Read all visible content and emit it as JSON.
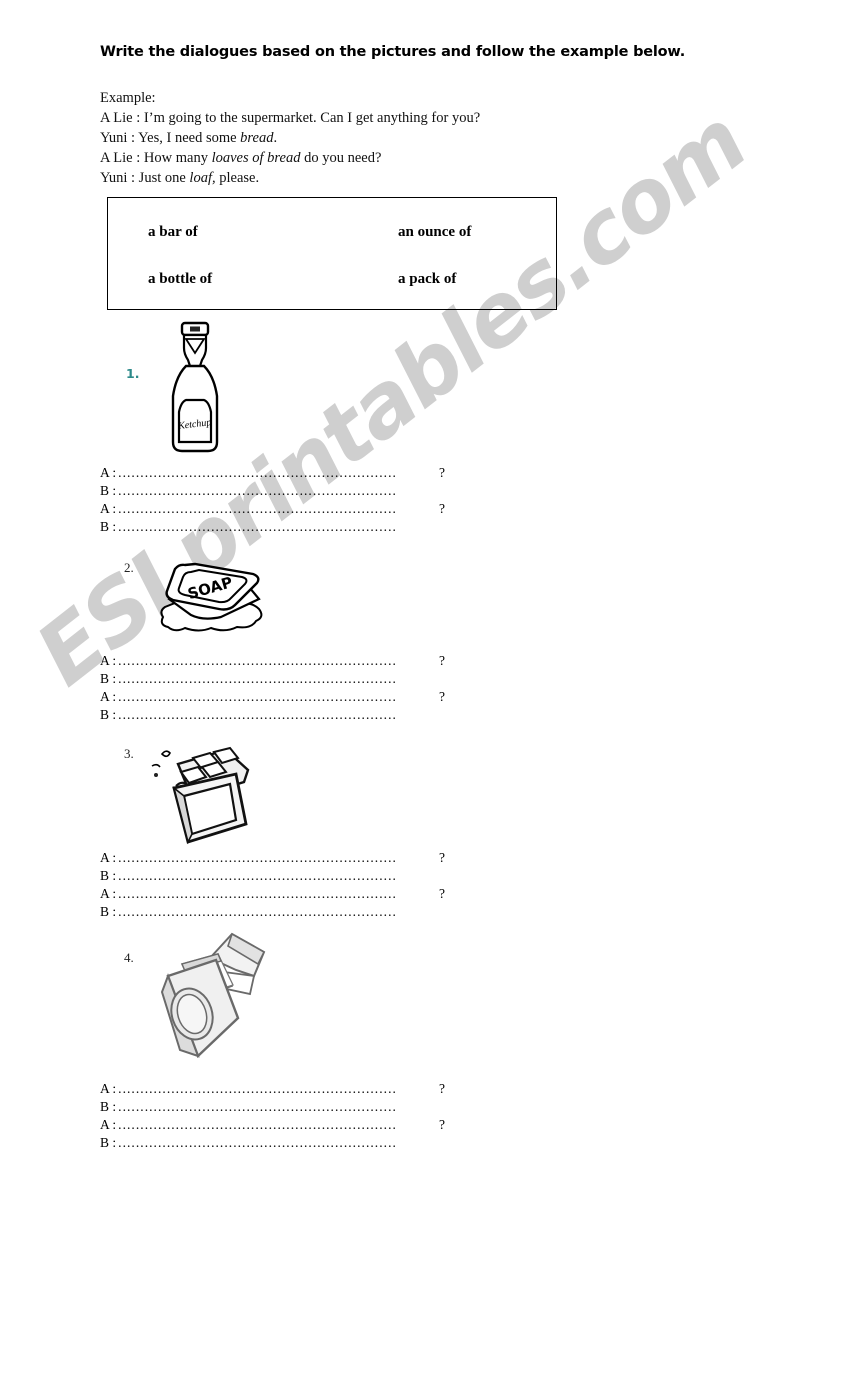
{
  "worksheet": {
    "title": "Write the dialogues based on the pictures and follow the example below.",
    "example": {
      "heading": "Example:",
      "lines": [
        {
          "speaker": "A Lie : ",
          "text": "I’m going to the supermarket. Can I get anything for you?",
          "italic_parts": []
        },
        {
          "speaker": "Yuni : ",
          "pre": "Yes, I need some ",
          "italic": "bread",
          "post": "."
        },
        {
          "speaker": "A Lie : ",
          "pre": "How many ",
          "italic": "loaves of bread",
          "post": " do you need?"
        },
        {
          "speaker": "Yuni : ",
          "pre": "Just one ",
          "italic": "loaf,",
          "post": " please."
        }
      ]
    },
    "word_bank": {
      "items": [
        "a bar of",
        "an ounce of",
        "a bottle of",
        "a pack of"
      ]
    },
    "exercises": [
      {
        "number": "1.",
        "number_color": "#2d8a8a",
        "picture_name": "ketchup-bottle",
        "picture_label": "Ketchup",
        "lines": [
          {
            "speaker": "A :",
            "dots": "...............................................................",
            "end": "?"
          },
          {
            "speaker": "B :",
            "dots": "...............................................................",
            "end": ""
          },
          {
            "speaker": "A :",
            "dots": "...............................................................",
            "end": "?"
          },
          {
            "speaker": "B :",
            "dots": "...............................................................",
            "end": ""
          }
        ]
      },
      {
        "number": "2.",
        "number_color": "#222222",
        "picture_name": "soap-bar",
        "picture_label": "SOAP",
        "lines": [
          {
            "speaker": "A :",
            "dots": "...............................................................",
            "end": "?"
          },
          {
            "speaker": "B :",
            "dots": "...............................................................",
            "end": ""
          },
          {
            "speaker": "A :",
            "dots": "...............................................................",
            "end": "?"
          },
          {
            "speaker": "B :",
            "dots": "...............................................................",
            "end": ""
          }
        ]
      },
      {
        "number": "3.",
        "number_color": "#222222",
        "picture_name": "chocolate-bar",
        "picture_label": "",
        "lines": [
          {
            "speaker": "A :",
            "dots": "...............................................................",
            "end": "?"
          },
          {
            "speaker": "B :",
            "dots": "...............................................................",
            "end": ""
          },
          {
            "speaker": "A :",
            "dots": "...............................................................",
            "end": "?"
          },
          {
            "speaker": "B :",
            "dots": "...............................................................",
            "end": ""
          }
        ]
      },
      {
        "number": "4.",
        "number_color": "#222222",
        "picture_name": "cigarette-pack",
        "picture_label": "",
        "lines": [
          {
            "speaker": "A :",
            "dots": "...............................................................",
            "end": "?"
          },
          {
            "speaker": "B :",
            "dots": "...............................................................",
            "end": ""
          },
          {
            "speaker": "A :",
            "dots": "...............................................................",
            "end": "?"
          },
          {
            "speaker": "B :",
            "dots": "...............................................................",
            "end": ""
          }
        ]
      }
    ],
    "watermark": {
      "text": "ESLprintables.com",
      "color": "#cfcfcf"
    }
  }
}
